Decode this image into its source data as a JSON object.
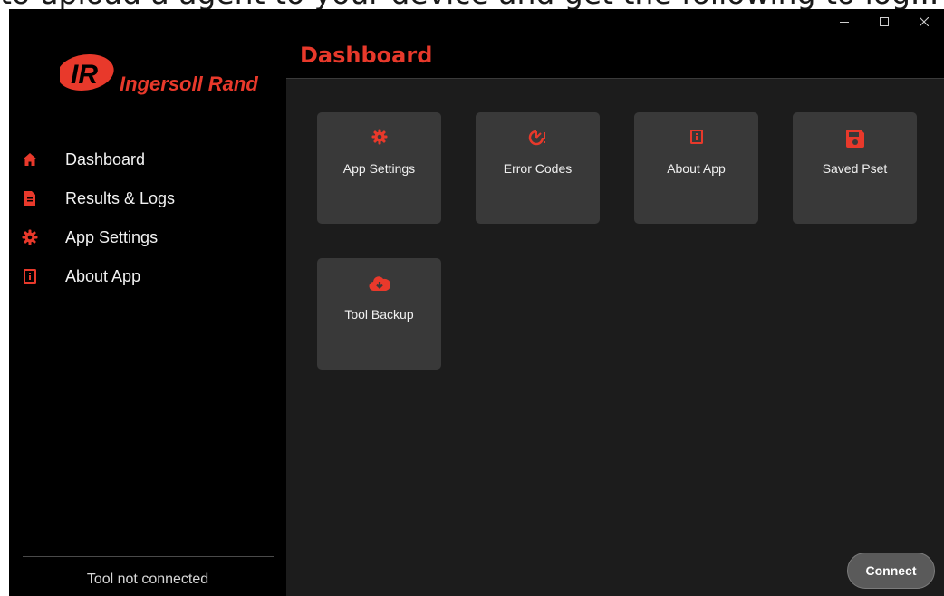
{
  "background_text": "to upload a agent to your device and get the following to log...",
  "app": {
    "brand": "Ingersoll Rand",
    "brand_mark": "IR",
    "accent_color": "#e8392b"
  },
  "window_controls": {
    "minimize": "minimize-icon",
    "maximize": "maximize-icon",
    "close": "close-icon"
  },
  "sidebar": {
    "items": [
      {
        "label": "Dashboard",
        "icon": "home-icon"
      },
      {
        "label": "Results & Logs",
        "icon": "file-icon"
      },
      {
        "label": "App Settings",
        "icon": "gear-icon"
      },
      {
        "label": "About App",
        "icon": "info-icon"
      }
    ],
    "status": "Tool not connected"
  },
  "header": {
    "title": "Dashboard"
  },
  "tiles": [
    {
      "label": "App Settings",
      "icon": "gear-icon"
    },
    {
      "label": "Error Codes",
      "icon": "error-timer-icon"
    },
    {
      "label": "About App",
      "icon": "info-icon"
    },
    {
      "label": "Saved Pset",
      "icon": "save-icon"
    },
    {
      "label": "Tool Backup",
      "icon": "cloud-download-icon"
    }
  ],
  "connect_button": {
    "label": "Connect"
  }
}
